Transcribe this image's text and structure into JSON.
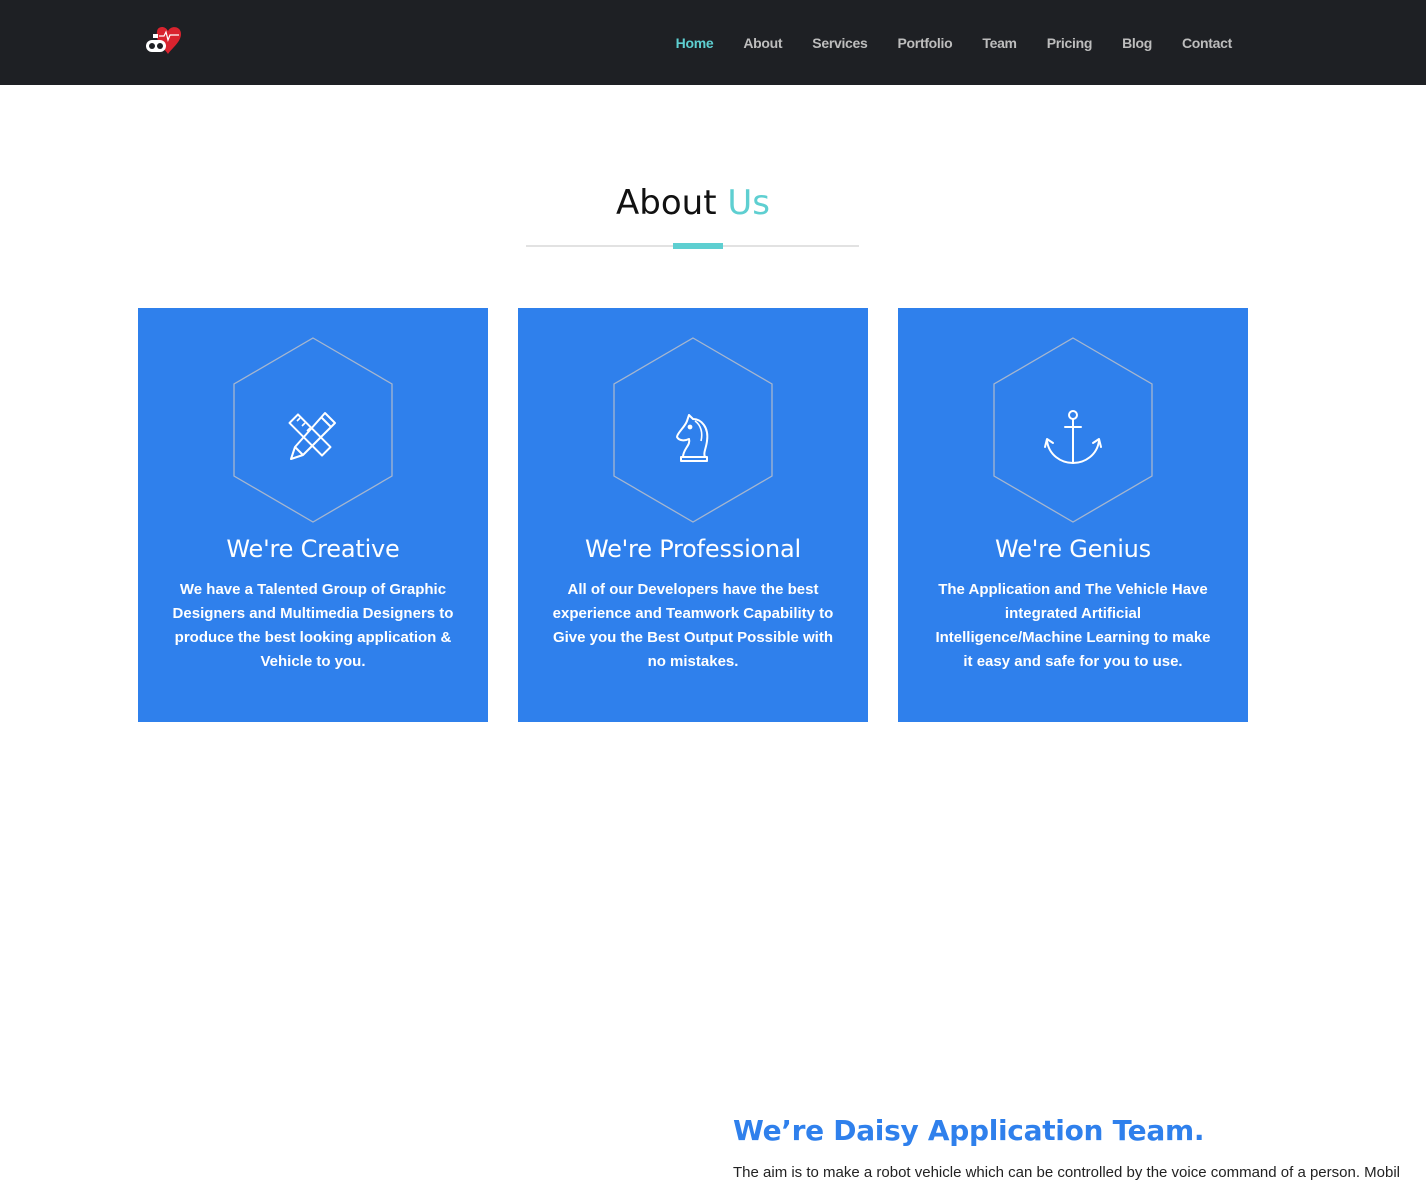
{
  "nav": {
    "items": [
      {
        "label": "Home",
        "active": true
      },
      {
        "label": "About"
      },
      {
        "label": "Services"
      },
      {
        "label": "Portfolio"
      },
      {
        "label": "Team"
      },
      {
        "label": "Pricing"
      },
      {
        "label": "Blog"
      },
      {
        "label": "Contact"
      }
    ]
  },
  "about": {
    "title_main": "About",
    "title_accent": "Us",
    "cards": [
      {
        "icon": "pencil-ruler-icon",
        "title": "We're Creative",
        "text": "We have a Talented Group of Graphic Designers and Multimedia Designers to produce the best looking application & Vehicle to you."
      },
      {
        "icon": "chess-knight-icon",
        "title": "We're Professional",
        "text": "All of our Developers have the best experience and Teamwork Capability to Give you the Best Output Possible with no mistakes."
      },
      {
        "icon": "anchor-icon",
        "title": "We're Genius",
        "text": "The Application and The Vehicle Have integrated Artificial Intelligence/Machine Learning to make it easy and safe for you to use."
      }
    ]
  },
  "team": {
    "heading": "We’re Daisy Application Team.",
    "text": "The aim is to make a robot vehicle which can be controlled by the voice command of a person. Mobil"
  },
  "colors": {
    "navbar_bg": "#1e2024",
    "accent": "#5ecfd1",
    "card_bg": "#2f80ec"
  }
}
